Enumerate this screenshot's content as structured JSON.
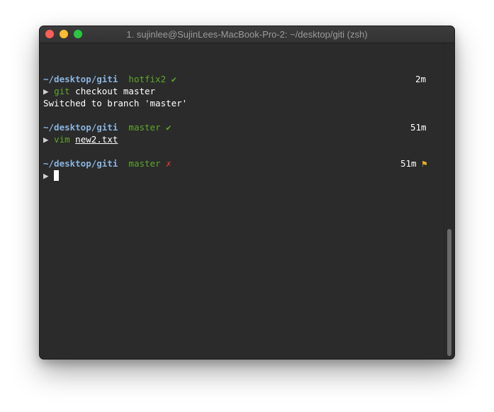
{
  "window": {
    "title": "1. sujinlee@SujinLees-MacBook-Pro-2: ~/desktop/giti (zsh)"
  },
  "terminal": {
    "prompt1": {
      "path": "~/desktop/giti",
      "branch": "hotfix2",
      "status_glyph": "✔",
      "time": "2m"
    },
    "cmd1": {
      "arrow": "▶",
      "program": "git",
      "args": " checkout master"
    },
    "output1": "Switched to branch 'master'",
    "prompt2": {
      "path": "~/desktop/giti",
      "branch": "master",
      "status_glyph": "✔",
      "time": "51m"
    },
    "cmd2": {
      "arrow": "▶",
      "program": "vim",
      "arg": "new2.txt"
    },
    "prompt3": {
      "path": "~/desktop/giti",
      "branch": "master",
      "status_glyph": "✗",
      "time": "51m",
      "flag_glyph": "⚑"
    },
    "cmd3": {
      "arrow": "▶"
    }
  },
  "colors": {
    "path": "#8ab4e0",
    "branch": "#5ea72a",
    "dirty": "#d9372c",
    "flag": "#e6b422",
    "background": "#2b2b2b"
  }
}
